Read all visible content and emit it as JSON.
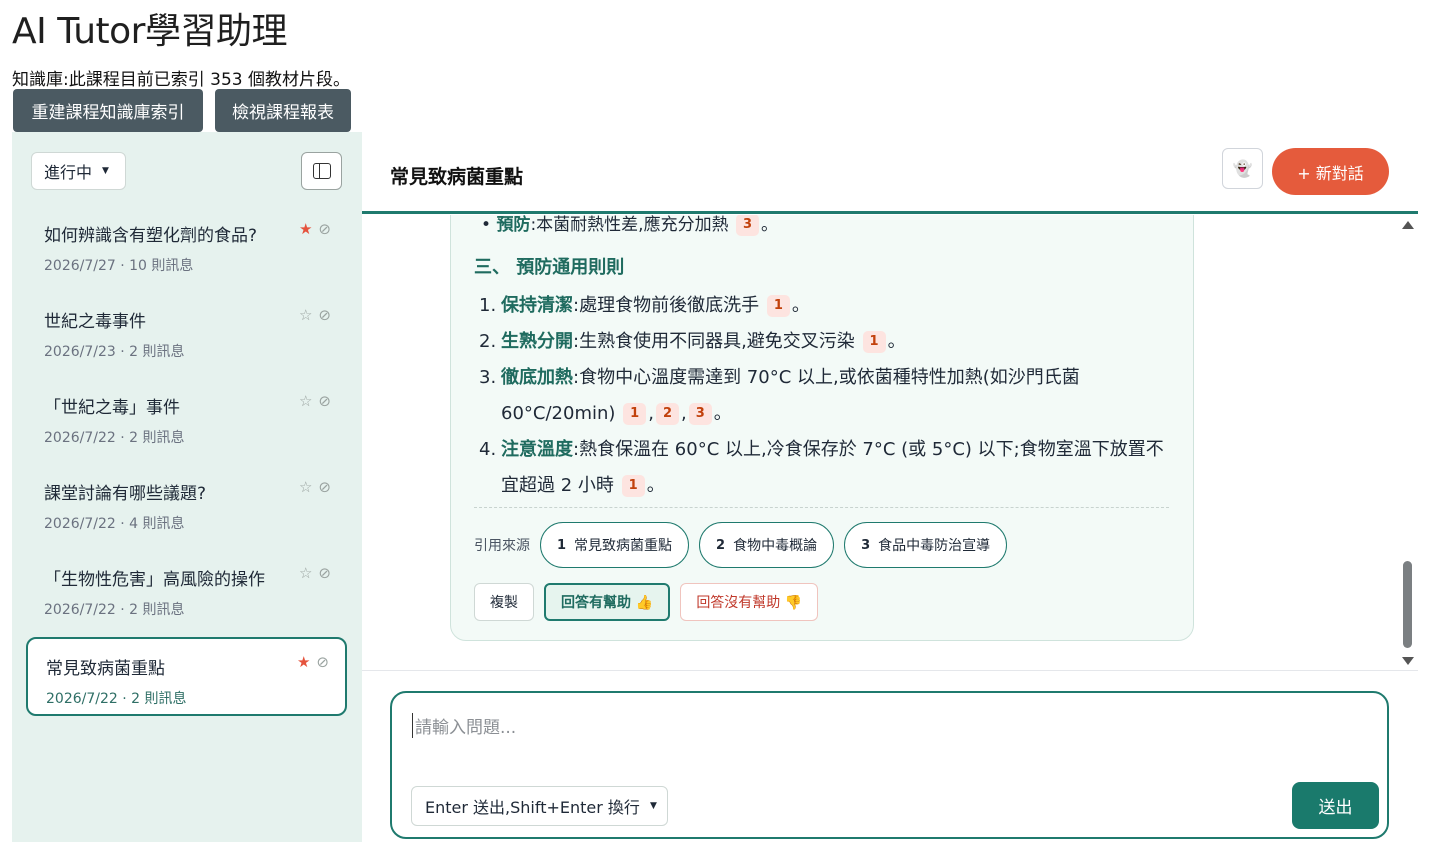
{
  "app": {
    "title": "AI Tutor學習助理",
    "kb_info": "知識庫:此課程目前已索引 353 個教材片段。",
    "rebuild_index_label": "重建課程知識庫索引",
    "view_report_label": "檢視課程報表"
  },
  "sidebar": {
    "filter_value": "進行中",
    "conversations": [
      {
        "title": "如何辨識含有塑化劑的食品?",
        "meta": "2026/7/27 · 10 則訊息",
        "starred": true,
        "active": false
      },
      {
        "title": "世紀之毒事件",
        "meta": "2026/7/23 · 2 則訊息",
        "starred": false,
        "active": false
      },
      {
        "title": "「世紀之毒」事件",
        "meta": "2026/7/22 · 2 則訊息",
        "starred": false,
        "active": false
      },
      {
        "title": "課堂討論有哪些議題?",
        "meta": "2026/7/22 · 4 則訊息",
        "starred": false,
        "active": false
      },
      {
        "title": "「生物性危害」高風險的操作",
        "meta": "2026/7/22 · 2 則訊息",
        "starred": false,
        "active": false
      },
      {
        "title": "常見致病菌重點",
        "meta": "2026/7/22 · 2 則訊息",
        "starred": true,
        "active": true
      }
    ]
  },
  "header": {
    "chat_title": "常見致病菌重點",
    "new_chat_label": "+ 新對話"
  },
  "message": {
    "cut_bold": "預防",
    "cut_text": ":本菌耐熱性差,應充分加熱",
    "cut_cite": "3",
    "cut_end": "。",
    "section_title": "三、 預防通用則則",
    "items": [
      {
        "num": "1.",
        "bold": "保持清潔",
        "text": ":處理食物前後徹底洗手",
        "cites": [
          "1"
        ]
      },
      {
        "num": "2.",
        "bold": "生熟分開",
        "text": ":生熟食使用不同器具,避免交叉污染",
        "cites": [
          "1"
        ]
      },
      {
        "num": "3.",
        "bold": "徹底加熱",
        "text": ":食物中心溫度需達到 70°C 以上,或依菌種特性加熱(如沙門氏菌 60°C/20min)",
        "cites": [
          "1",
          "2",
          "3"
        ]
      },
      {
        "num": "4.",
        "bold": "注意溫度",
        "text": ":熱食保溫在 60°C 以上,冷食保存於 7°C (或 5°C) 以下;食物室溫下放置不宜超過 2 小時",
        "cites": [
          "1"
        ]
      }
    ],
    "sources_label": "引用來源",
    "sources": [
      {
        "n": "1",
        "name": "常見致病菌重點"
      },
      {
        "n": "2",
        "name": "食物中毒概論"
      },
      {
        "n": "3",
        "name": "食品中毒防治宣導"
      }
    ],
    "copy_label": "複製",
    "helpful_label": "回答有幫助 👍",
    "not_helpful_label": "回答沒有幫助 👎"
  },
  "composer": {
    "placeholder": "請輸入問題...",
    "mode_value": "Enter 送出,Shift+Enter 換行",
    "send_label": "送出"
  },
  "colors": {
    "accent": "#1f7a6e",
    "new_chat": "#e55b3c",
    "sidebar_bg": "#e6f2ee",
    "top_button": "#4b5a62"
  }
}
